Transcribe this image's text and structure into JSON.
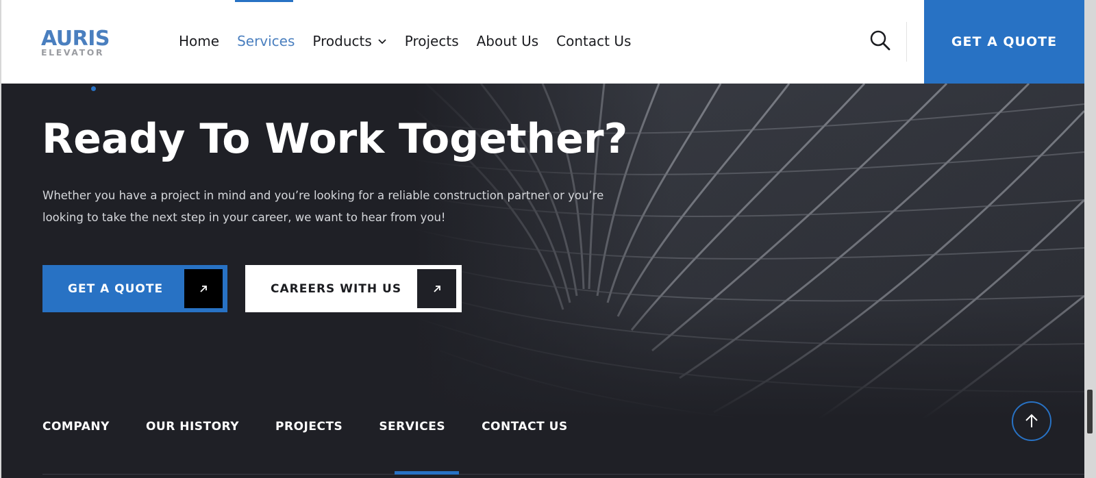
{
  "header": {
    "logo": {
      "main": "AURIS",
      "sub": "ELEVATOR"
    },
    "nav": [
      {
        "label": "Home",
        "active": false
      },
      {
        "label": "Services",
        "active": true
      },
      {
        "label": "Products",
        "active": false,
        "has_dropdown": true
      },
      {
        "label": "Projects",
        "active": false
      },
      {
        "label": "About Us",
        "active": false
      },
      {
        "label": "Contact Us",
        "active": false
      }
    ],
    "search_icon": "search-icon",
    "quote_button": "GET A QUOTE"
  },
  "hero": {
    "title": "Ready To Work Together?",
    "text": "Whether you have a project in mind and you’re looking for a reliable construction partner or you’re looking to take the next step in your career, we want to hear from you!",
    "buttons": {
      "primary": "GET A QUOTE",
      "secondary": "CAREERS WITH US"
    },
    "button_icon": "arrow-up-right-icon"
  },
  "footer_nav": [
    {
      "label": "COMPANY",
      "active": false
    },
    {
      "label": "OUR HISTORY",
      "active": false
    },
    {
      "label": "PROJECTS",
      "active": false
    },
    {
      "label": "SERVICES",
      "active": true
    },
    {
      "label": "CONTACT US",
      "active": false
    }
  ],
  "scroll_top_icon": "arrow-up-icon",
  "colors": {
    "accent": "#2872c4",
    "logo_blue": "#4a7fbf",
    "dark_bg": "#1f2026",
    "white": "#ffffff"
  }
}
